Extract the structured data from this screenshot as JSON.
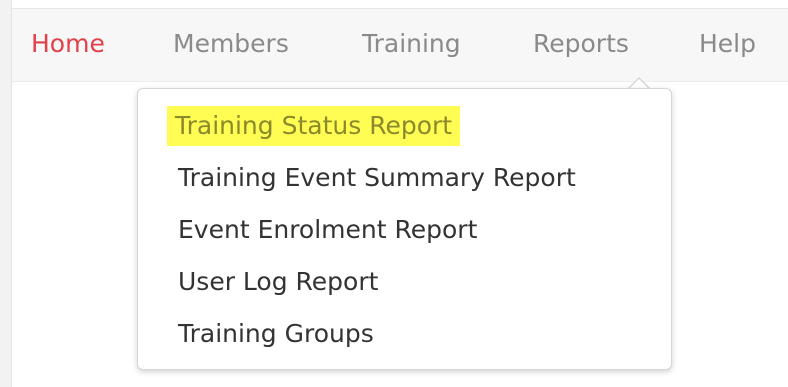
{
  "nav": {
    "items": [
      {
        "label": "Home"
      },
      {
        "label": "Members"
      },
      {
        "label": "Training"
      },
      {
        "label": "Reports"
      },
      {
        "label": "Help"
      }
    ]
  },
  "reports_menu": {
    "items": [
      {
        "label": "Training Status Report"
      },
      {
        "label": "Training Event Summary Report"
      },
      {
        "label": "Event Enrolment Report"
      },
      {
        "label": "User Log Report"
      },
      {
        "label": "Training Groups"
      }
    ]
  },
  "colors": {
    "active_nav": "#e0424a",
    "nav_text": "#8a8a8a",
    "highlight": "#fffc54"
  }
}
